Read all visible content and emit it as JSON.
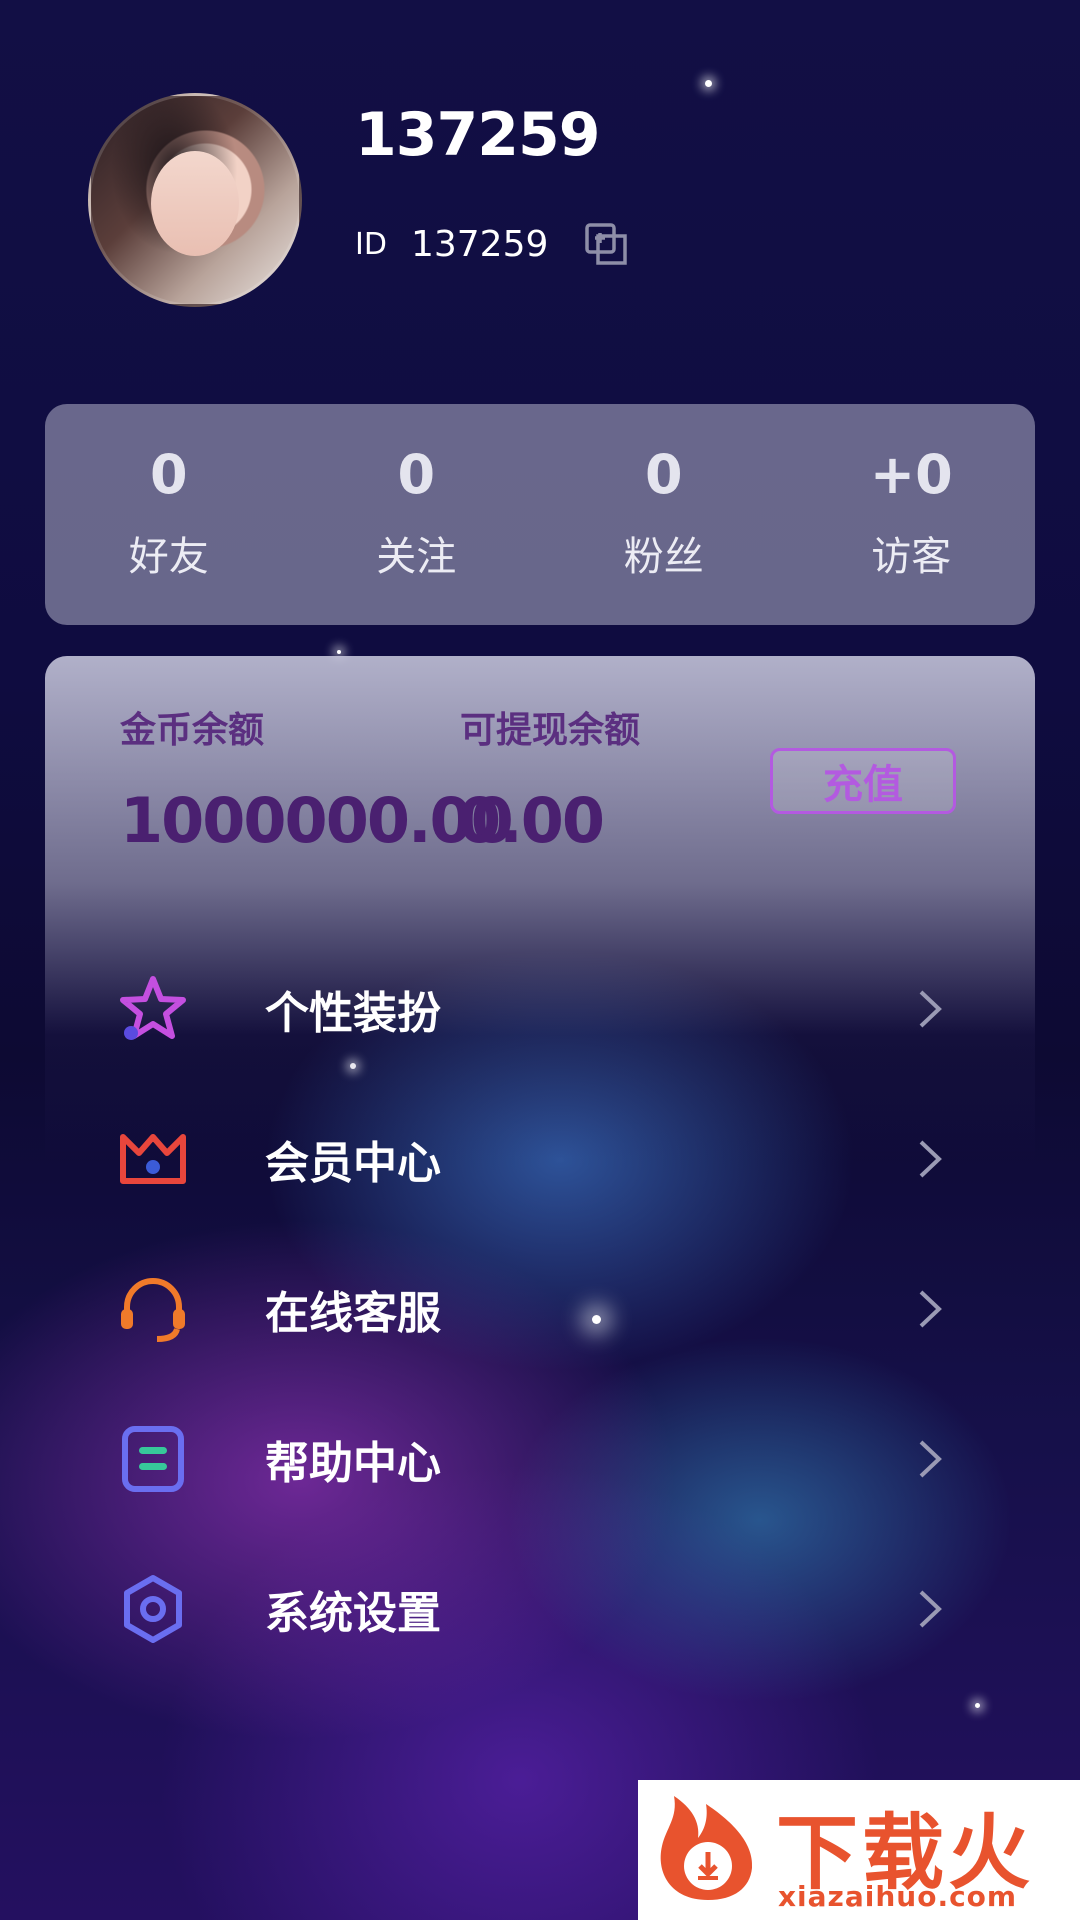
{
  "profile": {
    "username": "137259",
    "id_label": "ID",
    "id_value": "137259"
  },
  "stats": [
    {
      "value": "0",
      "label": "好友"
    },
    {
      "value": "0",
      "label": "关注"
    },
    {
      "value": "0",
      "label": "粉丝"
    },
    {
      "value": "+0",
      "label": "访客"
    }
  ],
  "wallet": {
    "coin_label": "金币余额",
    "coin_value": "1000000.00",
    "withdraw_label": "可提现余额",
    "withdraw_value": "0.00",
    "recharge_label": "充值"
  },
  "menu": [
    {
      "label": "个性装扮",
      "icon": "star-icon"
    },
    {
      "label": "会员中心",
      "icon": "crown-icon"
    },
    {
      "label": "在线客服",
      "icon": "headset-icon"
    },
    {
      "label": "帮助中心",
      "icon": "help-doc-icon"
    },
    {
      "label": "系统设置",
      "icon": "settings-gear-icon"
    }
  ],
  "watermark": {
    "brand": "下载火",
    "url": "xiazaihuo.com"
  },
  "colors": {
    "accent_purple": "#b35ae0",
    "wallet_text": "#4a2070",
    "watermark_orange": "#e8532e"
  }
}
